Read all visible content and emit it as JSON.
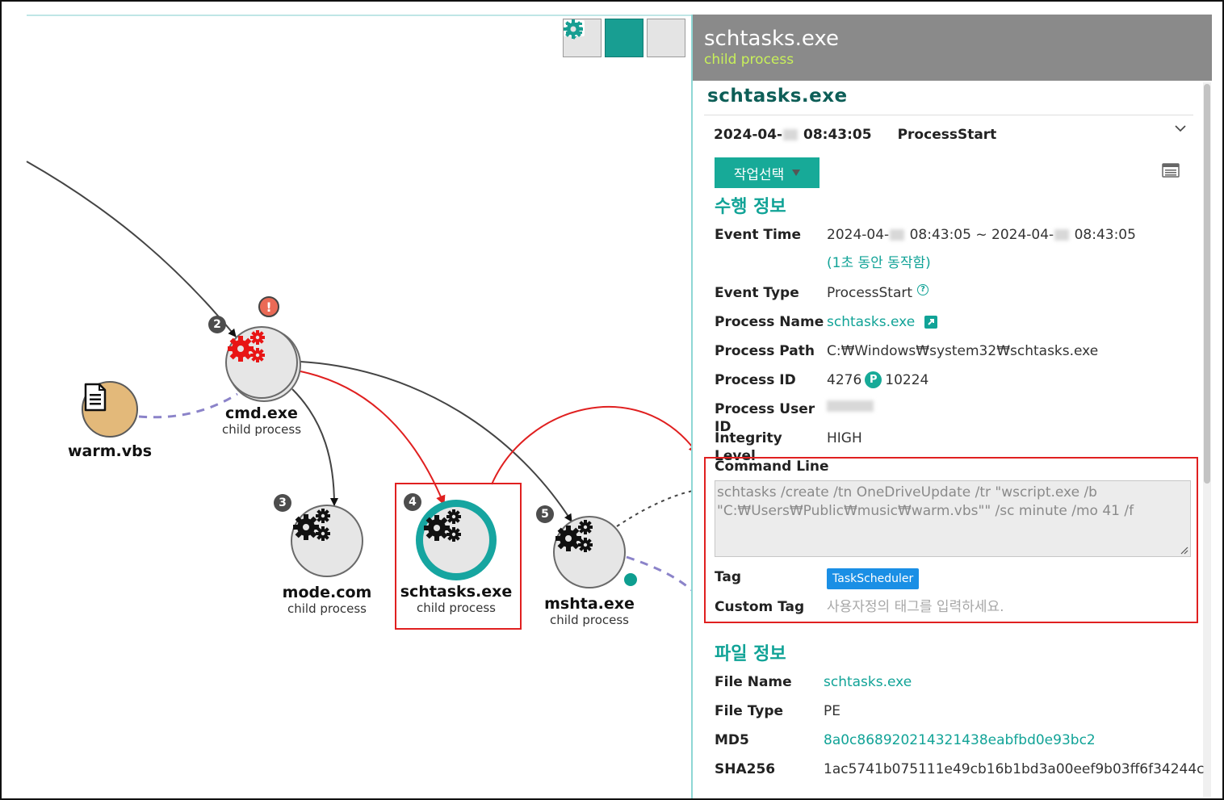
{
  "toolbar": {
    "buttons": [
      {
        "icon": "move-icon",
        "active": false
      },
      {
        "icon": "list-icon",
        "active": true
      },
      {
        "icon": "gear-icon",
        "active": false
      }
    ]
  },
  "graph": {
    "nodes": [
      {
        "id": "warm",
        "name": "warm.vbs",
        "sub": "",
        "icon": "file-icon"
      },
      {
        "id": "cmd",
        "name": "cmd.exe",
        "sub": "child process",
        "badge": "2",
        "alert": "!",
        "icon": "gears-icon-red"
      },
      {
        "id": "mode",
        "name": "mode.com",
        "sub": "child process",
        "badge": "3",
        "icon": "gears-icon"
      },
      {
        "id": "schtasks",
        "name": "schtasks.exe",
        "sub": "child process",
        "badge": "4",
        "icon": "gears-icon",
        "selected": true
      },
      {
        "id": "mshta",
        "name": "mshta.exe",
        "sub": "child process",
        "badge": "5",
        "icon": "gears-icon"
      }
    ]
  },
  "panel": {
    "header_title": "schtasks.exe",
    "header_sub": "child process",
    "process_title": "schtasks.exe",
    "event_date_pre": "2024-04-",
    "event_time": "08:43:05",
    "event_kind": "ProcessStart",
    "action_button": "작업선택",
    "exec_section": "수행 정보",
    "event_time_label": "Event Time",
    "event_time_a_pre": "2024-04-",
    "event_time_a_post": "08:43:05",
    "event_time_sep": "~",
    "event_time_b_pre": "2024-04-",
    "event_time_b_post": "08:43:05",
    "duration": "(1초 동안 동작함)",
    "event_type_label": "Event Type",
    "event_type": "ProcessStart",
    "process_name_label": "Process Name",
    "process_name": "schtasks.exe",
    "process_path_label": "Process Path",
    "process_path": "C:₩Windows₩system32₩schtasks.exe",
    "process_id_label": "Process ID",
    "process_id": "4276",
    "parent_marker": "P",
    "parent_id": "10224",
    "user_id_label": "Process User ID",
    "integrity_label": "Integrity Level",
    "integrity": "HIGH",
    "command_line_label": "Command Line",
    "command_line_1": "schtasks  /create /tn OneDriveUpdate /tr \"wscript.exe /b",
    "command_line_2": "\"C:₩Users₩Public₩music₩warm.vbs\"\" /sc minute /mo 41 /f",
    "tag_label": "Tag",
    "tag": "TaskScheduler",
    "custom_tag_label": "Custom Tag",
    "custom_tag_placeholder": "사용자정의 태그를 입력하세요.",
    "file_section": "파일 정보",
    "file_name_label": "File Name",
    "file_name": "schtasks.exe",
    "file_type_label": "File Type",
    "file_type": "PE",
    "md5_label": "MD5",
    "md5": "8a0c868920214321438eabfbd0e93bc2",
    "sha256_label": "SHA256",
    "sha256": "1ac5741b075111e49cb16b1bd3a00eef9b03ff6f34244c"
  },
  "colors": {
    "accent": "#11a397",
    "selected_ring": "#16a5a0",
    "highlight": "#e02020",
    "header_bg": "#8a8a8a",
    "tag_bg": "#1a8fe5"
  }
}
